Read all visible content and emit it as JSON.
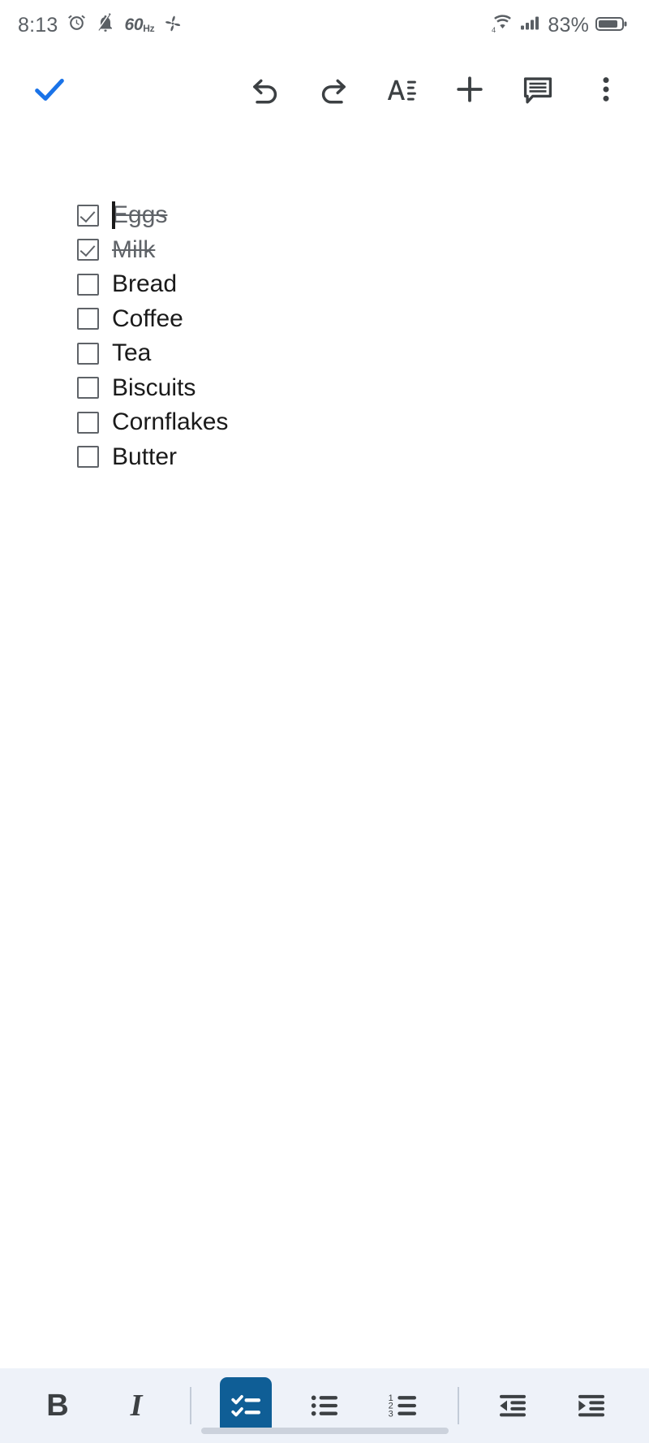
{
  "status_bar": {
    "time": "8:13",
    "refresh_rate": "60",
    "refresh_rate_unit": "Hz",
    "battery_percent": "83%",
    "icons": [
      "alarm-icon",
      "bell-muted-icon",
      "fan-icon",
      "wifi-icon",
      "cellular-signal-icon",
      "battery-icon"
    ]
  },
  "app_bar": {
    "done_label": "done-checkmark",
    "undo_label": "Undo",
    "redo_label": "Redo",
    "format_label": "Format",
    "insert_label": "Insert",
    "comment_label": "Comment",
    "more_label": "More options",
    "accent_color": "#1a73e8",
    "icon_color": "#3c4043"
  },
  "document": {
    "caret_visible": true,
    "items": [
      {
        "label": "Eggs",
        "checked": true
      },
      {
        "label": "Milk",
        "checked": true
      },
      {
        "label": "Bread",
        "checked": false
      },
      {
        "label": "Coffee",
        "checked": false
      },
      {
        "label": "Tea",
        "checked": false
      },
      {
        "label": "Biscuits",
        "checked": false
      },
      {
        "label": "Cornflakes",
        "checked": false
      },
      {
        "label": "Butter",
        "checked": false
      }
    ]
  },
  "format_bar": {
    "background": "#eef2f9",
    "active_color": "#0f5e96",
    "bold_label": "B",
    "italic_label": "I",
    "checklist_label": "Checklist",
    "bulleted_list_label": "Bulleted list",
    "numbered_list_label": "Numbered list",
    "numbered_list_digits": [
      "1",
      "2",
      "3"
    ],
    "decrease_indent_label": "Decrease indent",
    "increase_indent_label": "Increase indent",
    "active_button": "checklist"
  }
}
